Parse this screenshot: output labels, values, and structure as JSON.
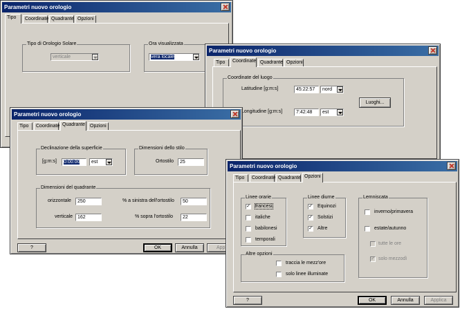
{
  "window_title": "Parametri nuovo orologio",
  "tabs": [
    "Tipo",
    "Coordinate",
    "Quadrante",
    "Opzioni"
  ],
  "tipo": {
    "group_solar": "Tipo di Orologio Solare",
    "solar_value": "verticale",
    "group_time": "Ora visualizzata",
    "time_value": "vera locale"
  },
  "coordinate": {
    "group": "Coordinate del luogo",
    "lat_label": "Latitudine [g:m:s]",
    "lat_value": "45:22:57",
    "lat_dir": "nord",
    "lon_label": "Longitudine [g:m:s]",
    "lon_value": "7:42:48",
    "lon_dir": "est",
    "places_button": "Luoghi..."
  },
  "quadrante": {
    "group_decl": "Declinazione della superficie",
    "decl_label": "[g:m:s]",
    "decl_value": "0:00:00",
    "decl_dir": "est",
    "group_stilo": "Dimensioni dello stilo",
    "ortostilo_label": "Ortostilo",
    "ortostilo_value": "25",
    "group_dim": "Dimensioni del quadrante",
    "orizz_label": "orizzontale",
    "orizz_value": "250",
    "vert_label": "verticale",
    "vert_value": "162",
    "left_label": "% a sinistra dell'ortostilo",
    "left_value": "50",
    "above_label": "% sopra l'ortostilo",
    "above_value": "22"
  },
  "opzioni": {
    "group_orarie": "Linee orarie",
    "francesi": "francesi",
    "italiche": "italiche",
    "babilonesi": "babilonesi",
    "temporali": "temporali",
    "group_diurne": "Linee diurne",
    "equinozi": "Equinozi",
    "solstizi": "Solstizi",
    "altre": "Altre",
    "group_lemniscata": "Lemniscata",
    "inverno": "inverno/primavera",
    "estate": "estate/autunno",
    "tutte": "tutte le ore",
    "solo_mezzodi": "solo mezzodì",
    "group_altre": "Altre opzioni",
    "mezzore": "traccia le mezz'ore",
    "illuminate": "solo linee illuminate"
  },
  "buttons": {
    "help": "?",
    "ok": "OK",
    "cancel": "Annulla",
    "apply": "Applica",
    "apply_cut": "Appl"
  },
  "check_mark": "✓"
}
